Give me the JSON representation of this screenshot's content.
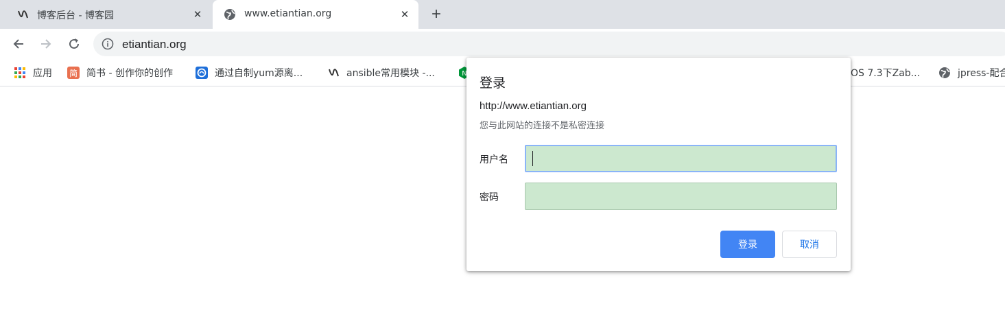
{
  "tabs": [
    {
      "title": "博客后台 - 博客园",
      "icon": "cnblogs-icon",
      "active": false
    },
    {
      "title": "www.etiantian.org",
      "icon": "globe-icon",
      "active": true
    }
  ],
  "toolbar": {
    "url": "etiantian.org"
  },
  "bookmarks": [
    {
      "label": "应用",
      "icon": "apps-grid-icon"
    },
    {
      "label": "简书 - 创作你的创作",
      "icon": "jianshu-icon"
    },
    {
      "label": "通过自制yum源离...",
      "icon": "blue-circle-icon"
    },
    {
      "label": "ansible常用模块 -...",
      "icon": "cnblogs-icon"
    },
    {
      "label": "",
      "icon": "nginx-icon"
    },
    {
      "label": "OS 7.3下Zab...",
      "icon": ""
    },
    {
      "label": "jpress-配合",
      "icon": "globe-icon"
    }
  ],
  "dialog": {
    "title": "登录",
    "site_url": "http://www.etiantian.org",
    "warning": "您与此网站的连接不是私密连接",
    "username_label": "用户名",
    "username_value": "",
    "password_label": "密码",
    "password_value": "",
    "login_button": "登录",
    "cancel_button": "取消"
  },
  "colors": {
    "tabstrip_bg": "#dee1e6",
    "omnibox_bg": "#f1f3f4",
    "field_autofill_bg": "#cce8cf",
    "primary_button": "#4285f4",
    "focus_ring": "#8ab4f8"
  }
}
